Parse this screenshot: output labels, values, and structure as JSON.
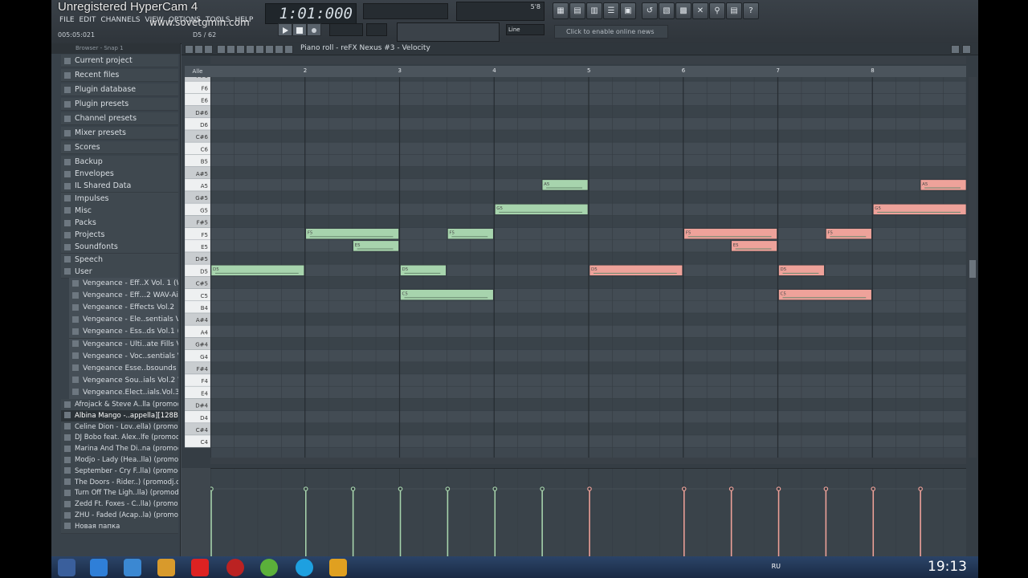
{
  "app": {
    "watermark": "Unregistered HyperCam 4",
    "menu": [
      "FILE",
      "EDIT",
      "CHANNELS",
      "VIEW",
      "OPTIONS",
      "TOOLS",
      "HELP"
    ],
    "site": "www.sovetgmin.com",
    "hint_left": "005:05:021",
    "hint_right": "D5 / 62",
    "time_display": "1:01:000",
    "tempo_small": "5'8",
    "snap_label": "Line",
    "news_text": "Click to enable online news"
  },
  "browser": {
    "header": "Browser - Snap 1",
    "items": [
      "Current project",
      "Recent files",
      "Plugin database",
      "Plugin presets",
      "Channel presets",
      "Mixer presets",
      "Scores",
      "Backup",
      "Envelopes",
      "IL Shared Data",
      "Impulses",
      "Misc",
      "Packs",
      "Projects",
      "Soundfonts",
      "Speech",
      "User"
    ],
    "user_children": [
      "Vengeance - Eff..X Vol. 1 (WAV)",
      "Vengeance - Eff...2 WAV-AiRISO",
      "Vengeance - Effects Vol.2",
      "Vengeance - Ele..sentials Vol. 1",
      "Vengeance - Ess..ds Vol.1 (WAV)",
      "Vengeance - Ulti..ate Fills Vol.2",
      "Vengeance - Voc..sentials Vol.1",
      "Vengeance Esse..bsounds Vol.2",
      "Vengeance Sou..ials Vol.2 WAV",
      "Vengeance.Elect..ials.Vol.3.WAV"
    ],
    "files": [
      "Afrojack & Steve A..lla (promodj.com)",
      "Albina Mango -..appella][128BPM]",
      "Celine Dion - Lov..ella) (promodj.com)",
      "DJ Bobo feat. Alex..lfe (promodj.com)",
      "Marina And The Di..na (promodj.com)",
      "Modjo - Lady (Hea..lla) (promodj.com)",
      "September - Cry F..lla) (promodj.com)",
      "The Doors - Rider..) (promodj.com) (1)",
      "Turn Off The Ligh..lla) (promodj.com)",
      "Zedd Ft. Foxes - C..lla) (promodj.com)",
      "ZHU - Faded (Acap..la) (promodj.com)",
      "Новая папка"
    ]
  },
  "pianoroll": {
    "title": "Piano roll - reFX Nexus #3 - Velocity",
    "key_label": "Alle",
    "bars": [
      "2",
      "3",
      "4",
      "5",
      "6",
      "7",
      "8"
    ],
    "keys": [
      "F#6",
      "F6",
      "E6",
      "D#6",
      "D6",
      "C#6",
      "C6",
      "B5",
      "A#5",
      "A5",
      "G#5",
      "G5",
      "F#5",
      "F5",
      "E5",
      "D#5",
      "D5",
      "C#5",
      "C5",
      "B4",
      "A#4",
      "A4",
      "G#4",
      "G4",
      "F#4",
      "F4",
      "E4",
      "D#4",
      "D4",
      "C#4",
      "C4"
    ],
    "colors": {
      "green": "#a7d4ad",
      "red": "#eea29a",
      "grid": "#3e474f"
    },
    "notes": [
      {
        "label": "D5",
        "pitch": "D5",
        "start": 1.0,
        "len": 1.0,
        "color": "green"
      },
      {
        "label": "F5",
        "pitch": "F5",
        "start": 2.0,
        "len": 1.0,
        "color": "green"
      },
      {
        "label": "E5",
        "pitch": "E5",
        "start": 2.5,
        "len": 0.5,
        "color": "green"
      },
      {
        "label": "D5",
        "pitch": "D5",
        "start": 3.0,
        "len": 0.5,
        "color": "green"
      },
      {
        "label": "C5",
        "pitch": "C5",
        "start": 3.0,
        "len": 1.0,
        "color": "green"
      },
      {
        "label": "F5",
        "pitch": "F5",
        "start": 3.5,
        "len": 0.5,
        "color": "green"
      },
      {
        "label": "G5",
        "pitch": "G5",
        "start": 4.0,
        "len": 1.0,
        "color": "green"
      },
      {
        "label": "A5",
        "pitch": "A5",
        "start": 4.5,
        "len": 0.5,
        "color": "green"
      },
      {
        "label": "D5",
        "pitch": "D5",
        "start": 5.0,
        "len": 1.0,
        "color": "red"
      },
      {
        "label": "F5",
        "pitch": "F5",
        "start": 6.0,
        "len": 1.0,
        "color": "red"
      },
      {
        "label": "E5",
        "pitch": "E5",
        "start": 6.5,
        "len": 0.5,
        "color": "red"
      },
      {
        "label": "D5",
        "pitch": "D5",
        "start": 7.0,
        "len": 0.5,
        "color": "red"
      },
      {
        "label": "C5",
        "pitch": "C5",
        "start": 7.0,
        "len": 1.0,
        "color": "red"
      },
      {
        "label": "F5",
        "pitch": "F5",
        "start": 7.5,
        "len": 0.5,
        "color": "red"
      },
      {
        "label": "G5",
        "pitch": "G5",
        "start": 8.0,
        "len": 1.0,
        "color": "red"
      },
      {
        "label": "A5",
        "pitch": "A5",
        "start": 8.5,
        "len": 0.5,
        "color": "red"
      }
    ],
    "velocity": [
      {
        "pos": 1.0,
        "color": "green"
      },
      {
        "pos": 2.0,
        "color": "green"
      },
      {
        "pos": 2.5,
        "color": "green"
      },
      {
        "pos": 3.0,
        "color": "green"
      },
      {
        "pos": 3.5,
        "color": "green"
      },
      {
        "pos": 4.0,
        "color": "green"
      },
      {
        "pos": 4.5,
        "color": "green"
      },
      {
        "pos": 5.0,
        "color": "red"
      },
      {
        "pos": 6.0,
        "color": "red"
      },
      {
        "pos": 6.5,
        "color": "red"
      },
      {
        "pos": 7.0,
        "color": "red"
      },
      {
        "pos": 7.5,
        "color": "red"
      },
      {
        "pos": 8.0,
        "color": "red"
      },
      {
        "pos": 8.5,
        "color": "red"
      }
    ]
  },
  "taskbar": {
    "icons": [
      "windows-logo",
      "ie-icon",
      "explorer-icon",
      "media-icon",
      "yandex-icon",
      "antivirus-icon",
      "utorrent-icon",
      "skype-icon",
      "fl-studio-icon"
    ],
    "lang": "RU",
    "clock": "19:13"
  }
}
